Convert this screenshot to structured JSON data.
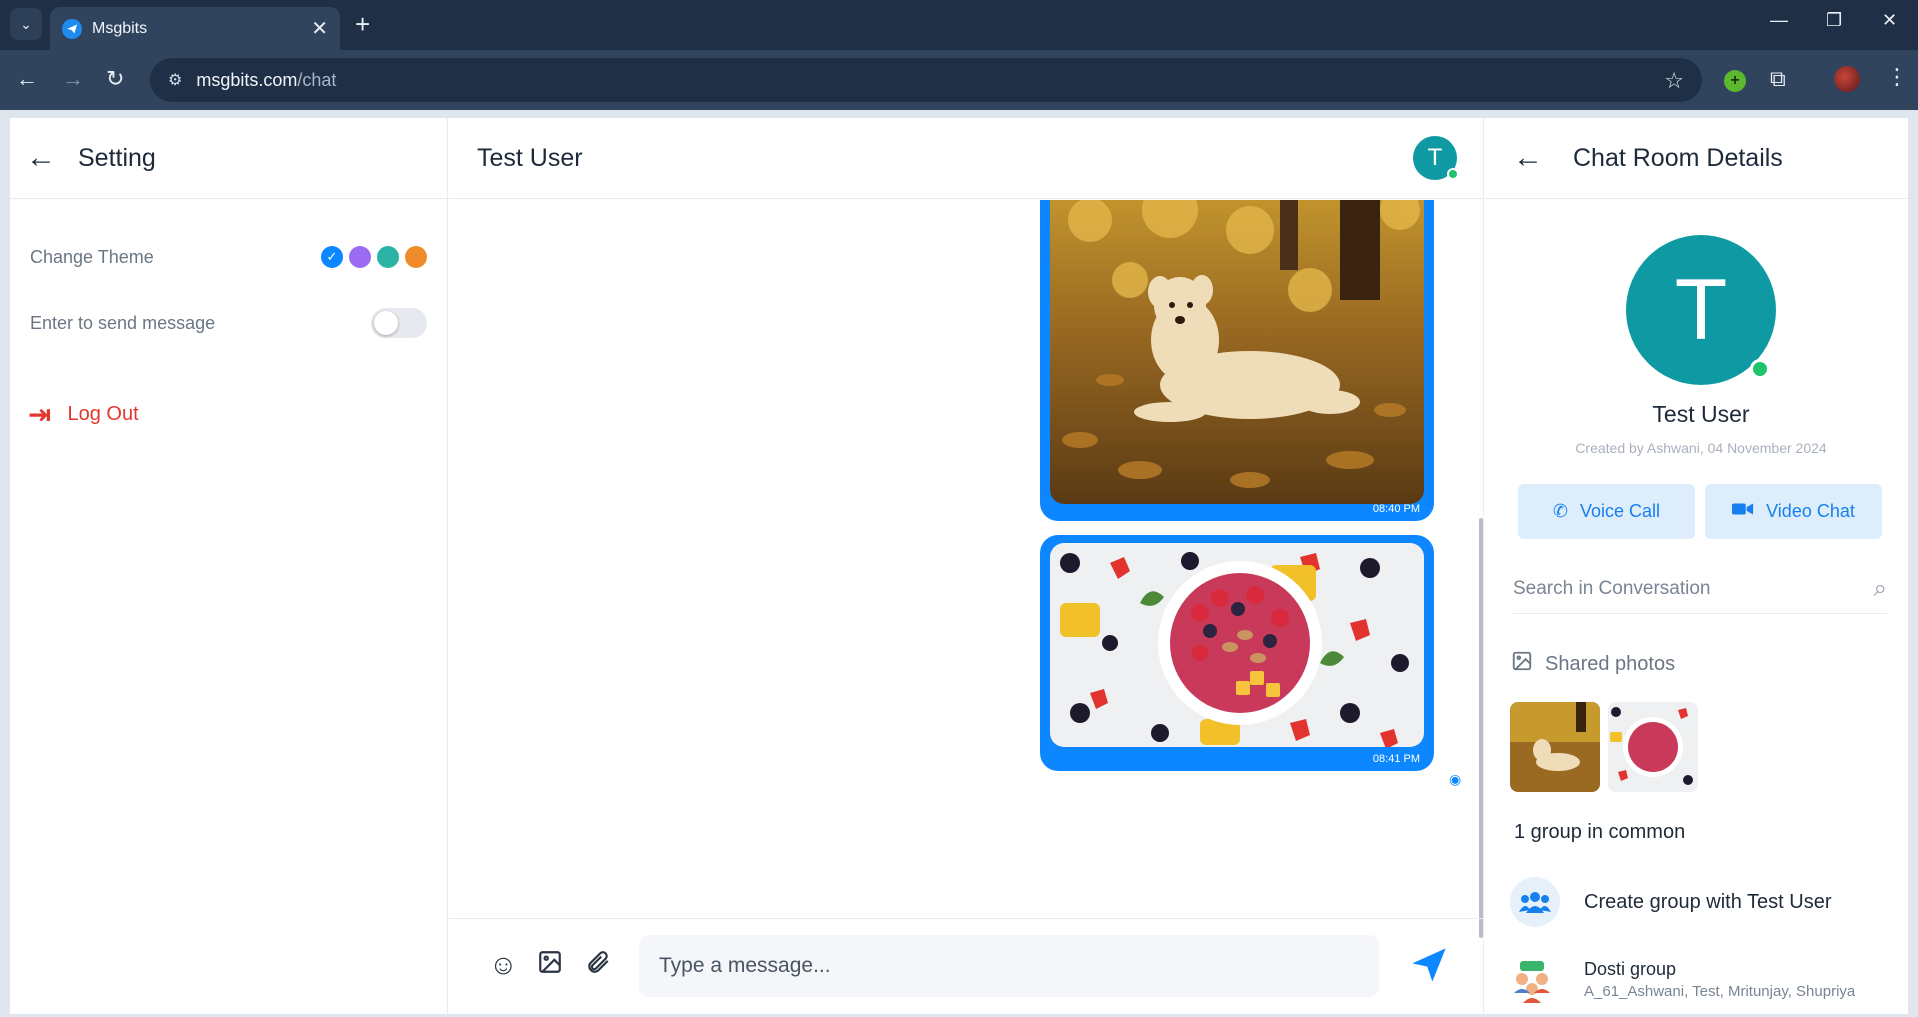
{
  "browser": {
    "tab_title": "Msgbits",
    "url_host": "msgbits.com",
    "url_path": "/chat"
  },
  "settings": {
    "title": "Setting",
    "change_theme_label": "Change Theme",
    "theme_colors": [
      "#0d87ff",
      "#9b6bf2",
      "#2bb3a6",
      "#ef8a2d"
    ],
    "selected_theme_index": 0,
    "enter_to_send_label": "Enter to send message",
    "enter_to_send_enabled": false,
    "logout_label": "Log Out"
  },
  "chat": {
    "title": "Test User",
    "avatar_letter": "T",
    "messages": [
      {
        "type": "image",
        "image": "dog-in-autumn-leaves",
        "time": "08:40 PM"
      },
      {
        "type": "image",
        "image": "fruit-smoothie-bowl",
        "time": "08:41 PM",
        "seen": true
      }
    ],
    "composer_placeholder": "Type a message..."
  },
  "details": {
    "title": "Chat Room Details",
    "avatar_letter": "T",
    "name": "Test User",
    "created_by": "Created by Ashwani, 04 November 2024",
    "voice_call_label": "Voice Call",
    "video_chat_label": "Video Chat",
    "search_placeholder": "Search in Conversation",
    "shared_photos_label": "Shared photos",
    "common_groups_label": "1 group in common",
    "create_group_label": "Create group with Test User",
    "group": {
      "name": "Dosti group",
      "members": "A_61_Ashwani, Test, Mritunjay, Shupriya"
    }
  },
  "colors": {
    "accent": "#0d87ff",
    "avatar": "#0f9aa3",
    "online": "#1fc36a",
    "logout": "#e2372f"
  }
}
